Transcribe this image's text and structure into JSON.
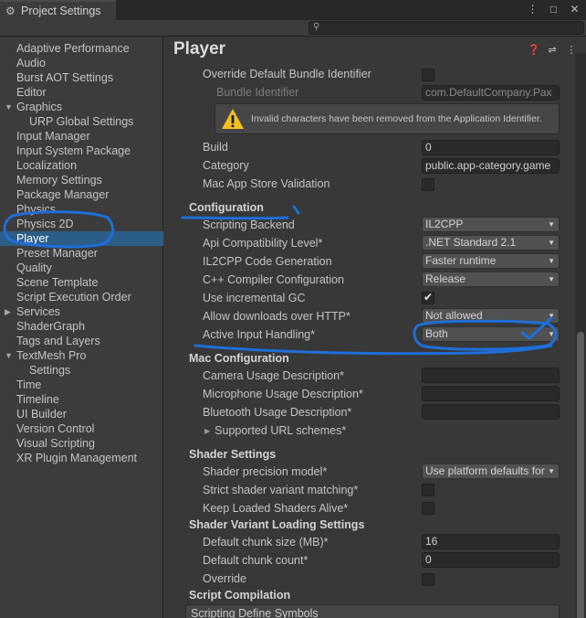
{
  "window": {
    "tab_title": "Project Settings"
  },
  "search": {
    "placeholder": ""
  },
  "sidebar": {
    "items": [
      {
        "label": "Adaptive Performance",
        "level": 0
      },
      {
        "label": "Audio",
        "level": 0
      },
      {
        "label": "Burst AOT Settings",
        "level": 0
      },
      {
        "label": "Editor",
        "level": 0
      },
      {
        "label": "Graphics",
        "level": 0,
        "expanded": true
      },
      {
        "label": "URP Global Settings",
        "level": 1
      },
      {
        "label": "Input Manager",
        "level": 0
      },
      {
        "label": "Input System Package",
        "level": 0
      },
      {
        "label": "Localization",
        "level": 0
      },
      {
        "label": "Memory Settings",
        "level": 0
      },
      {
        "label": "Package Manager",
        "level": 0
      },
      {
        "label": "Physics",
        "level": 0
      },
      {
        "label": "Physics 2D",
        "level": 0
      },
      {
        "label": "Player",
        "level": 0,
        "selected": true
      },
      {
        "label": "Preset Manager",
        "level": 0
      },
      {
        "label": "Quality",
        "level": 0
      },
      {
        "label": "Scene Template",
        "level": 0
      },
      {
        "label": "Script Execution Order",
        "level": 0
      },
      {
        "label": "Services",
        "level": 0,
        "collapsed": true
      },
      {
        "label": "ShaderGraph",
        "level": 0
      },
      {
        "label": "Tags and Layers",
        "level": 0
      },
      {
        "label": "TextMesh Pro",
        "level": 0,
        "expanded": true
      },
      {
        "label": "Settings",
        "level": 1
      },
      {
        "label": "Time",
        "level": 0
      },
      {
        "label": "Timeline",
        "level": 0
      },
      {
        "label": "UI Builder",
        "level": 0
      },
      {
        "label": "Version Control",
        "level": 0
      },
      {
        "label": "Visual Scripting",
        "level": 0
      },
      {
        "label": "XR Plugin Management",
        "level": 0
      }
    ]
  },
  "main": {
    "title": "Player",
    "mac_app_store": {
      "override_bundle_label": "Override Default Bundle Identifier",
      "override_bundle_checked": false,
      "bundle_identifier_label": "Bundle Identifier",
      "bundle_identifier_value": "com.DefaultCompany.Pax",
      "warning_text": "Invalid characters have been removed from the Application Identifier.",
      "build_label": "Build",
      "build_value": "0",
      "category_label": "Category",
      "category_value": "public.app-category.game",
      "validation_label": "Mac App Store Validation",
      "validation_checked": false
    },
    "configuration": {
      "header": "Configuration",
      "scripting_backend_label": "Scripting Backend",
      "scripting_backend_value": "IL2CPP",
      "api_compat_label": "Api Compatibility Level*",
      "api_compat_value": ".NET Standard 2.1",
      "il2cpp_codegen_label": "IL2CPP Code Generation",
      "il2cpp_codegen_value": "Faster runtime",
      "cpp_compiler_label": "C++ Compiler Configuration",
      "cpp_compiler_value": "Release",
      "incremental_gc_label": "Use incremental GC",
      "incremental_gc_checked": true,
      "allow_http_label": "Allow downloads over HTTP*",
      "allow_http_value": "Not allowed",
      "active_input_label": "Active Input Handling*",
      "active_input_value": "Both"
    },
    "mac_configuration": {
      "header": "Mac Configuration",
      "camera_label": "Camera Usage Description*",
      "camera_value": "",
      "microphone_label": "Microphone Usage Description*",
      "microphone_value": "",
      "bluetooth_label": "Bluetooth Usage Description*",
      "bluetooth_value": "",
      "url_schemes_label": "Supported URL schemes*"
    },
    "shader_settings": {
      "header": "Shader Settings",
      "precision_label": "Shader precision model*",
      "precision_value": "Use platform defaults for",
      "strict_variant_label": "Strict shader variant matching*",
      "strict_variant_checked": false,
      "keep_loaded_label": "Keep Loaded Shaders Alive*",
      "keep_loaded_checked": false
    },
    "shader_variant_loading": {
      "header": "Shader Variant Loading Settings",
      "chunk_size_label": "Default chunk size (MB)*",
      "chunk_size_value": "16",
      "chunk_count_label": "Default chunk count*",
      "chunk_count_value": "0",
      "override_label": "Override",
      "override_checked": false
    },
    "script_compilation": {
      "header": "Script Compilation",
      "define_symbols_label": "Scripting Define Symbols"
    }
  },
  "icons": {
    "tab": "gear-icon",
    "help": "help-icon",
    "preset": "preset-icon",
    "more": "more-options-icon",
    "warning": "warning-icon"
  },
  "colors": {
    "selection": "#2c5d87",
    "annotation_ink": "#1e6fd9",
    "warning_yellow": "#f2c01e"
  }
}
